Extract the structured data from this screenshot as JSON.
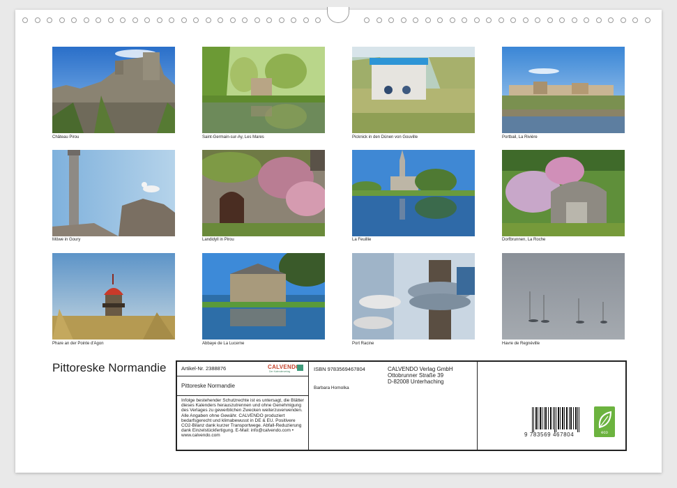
{
  "photos": [
    {
      "caption": "Château Pirou",
      "scene": "castle-photo"
    },
    {
      "caption": "Saint-Germain-sur-Ay, Les Mares",
      "scene": "pond-village-photo"
    },
    {
      "caption": "Picknick in den Dünen von Gouville",
      "scene": "beach-hut-photo"
    },
    {
      "caption": "Portbail, La Rivière",
      "scene": "river-village-photo"
    },
    {
      "caption": "Möwe in Goury",
      "scene": "lighthouse-gull-photo"
    },
    {
      "caption": "Landidyll in Pirou",
      "scene": "cottage-door-photo"
    },
    {
      "caption": "La Feuillie",
      "scene": "church-reflection-photo"
    },
    {
      "caption": "Dorfbrunnen, La Roche",
      "scene": "hydrangea-well-photo"
    },
    {
      "caption": "Phare an der Pointe d'Agon",
      "scene": "red-lighthouse-photo"
    },
    {
      "caption": "Abbaye de La Lucerne",
      "scene": "abbey-reflection-photo"
    },
    {
      "caption": "Port Racine",
      "scene": "rope-post-photo"
    },
    {
      "caption": "Havre de Regnéville",
      "scene": "misty-boats-photo"
    }
  ],
  "calendar_title": "Pittoreske Normandie",
  "info": {
    "article": "Artikel-Nr. 2388876",
    "logo_text": "CALVENDO",
    "logo_sub": "Der Kalenderverlag",
    "product_title": "Pittoreske Normandie",
    "legal_text": "Infolge bestehender Schutzrechte ist es untersagt, die Blätter dieses Kalenders herauszutrennen und ohne Genehmigung des Verlages zu gewerblichen Zwecken weiterzuverwenden. Alle Angaben ohne Gewähr. CALVENDO produziert bedarfsgerecht und klimabewusst in DE & EU. Positivere CO2-Bilanz dank kurzer Transportwege. Abfall-Reduzierung dank Einzelstückfertigung. E-Mail: info@calvendo.com • www.calvendo.com",
    "isbn": "ISBN 9783569467804",
    "author": "Barbara Homolka",
    "publisher_name": "CALVENDO Verlag GmbH",
    "publisher_street": "Ottobrunner Straße 39",
    "publisher_city": "D-82008 Unterhaching",
    "barcode_number": "9 783569 467804",
    "eco_label": "eco"
  },
  "colors": {
    "eco_green": "#6cb33f",
    "calvendo_red": "#c4422b"
  }
}
